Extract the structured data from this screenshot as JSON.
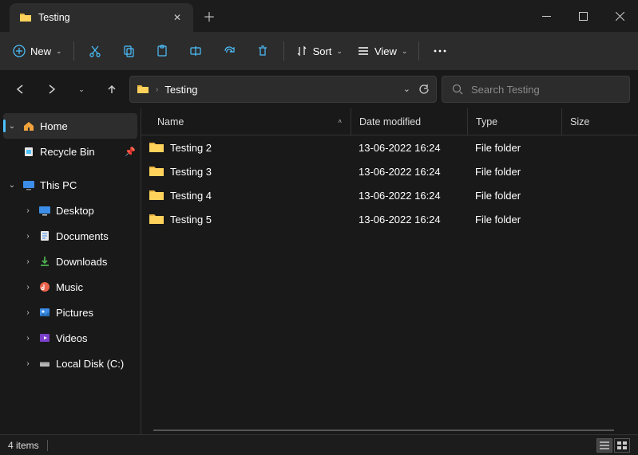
{
  "tab": {
    "title": "Testing"
  },
  "toolbar": {
    "new": "New",
    "sort": "Sort",
    "view": "View"
  },
  "address": {
    "crumb": "Testing"
  },
  "search": {
    "placeholder": "Search Testing"
  },
  "sidebar": {
    "home": "Home",
    "recycle": "Recycle Bin",
    "thispc": "This PC",
    "desktop": "Desktop",
    "documents": "Documents",
    "downloads": "Downloads",
    "music": "Music",
    "pictures": "Pictures",
    "videos": "Videos",
    "localdisk": "Local Disk (C:)"
  },
  "columns": {
    "name": "Name",
    "date": "Date modified",
    "type": "Type",
    "size": "Size"
  },
  "rows": [
    {
      "name": "Testing 2",
      "date": "13-06-2022 16:24",
      "type": "File folder"
    },
    {
      "name": "Testing 3",
      "date": "13-06-2022 16:24",
      "type": "File folder"
    },
    {
      "name": "Testing 4",
      "date": "13-06-2022 16:24",
      "type": "File folder"
    },
    {
      "name": "Testing 5",
      "date": "13-06-2022 16:24",
      "type": "File folder"
    }
  ],
  "status": {
    "items": "4 items"
  }
}
